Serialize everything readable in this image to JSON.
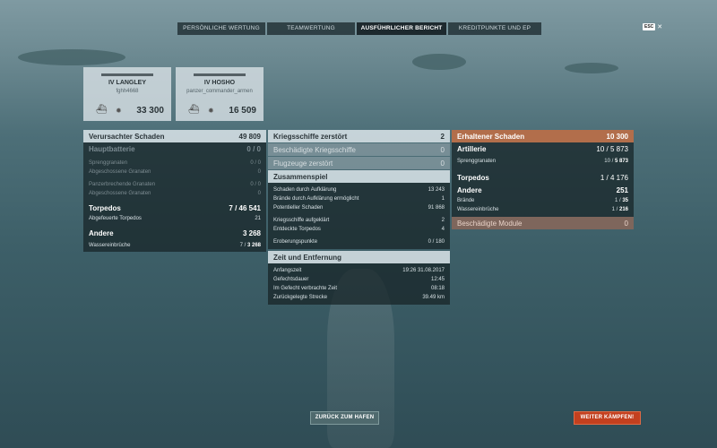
{
  "tabs": [
    {
      "label": "Persönliche Wertung",
      "active": false
    },
    {
      "label": "Teamwertung",
      "active": false
    },
    {
      "label": "Ausführlicher Bericht",
      "active": true
    },
    {
      "label": "Kreditpunkte und EP",
      "active": false
    }
  ],
  "close": {
    "esc": "ESC",
    "x": "✕"
  },
  "cards": [
    {
      "name": "IV LANGLEY",
      "player": "fghh4668",
      "score": "33 300"
    },
    {
      "name": "IV HOSHO",
      "player": "panzer_commander_armen",
      "score": "16 509"
    }
  ],
  "left": {
    "header": {
      "label": "Verursachter Schaden",
      "value": "49 809"
    },
    "hauptbatterie": {
      "label": "Hauptbatterie",
      "value": "0 / 0"
    },
    "hb_lines": [
      {
        "label": "Sprenggranaten",
        "value": "0 / 0"
      },
      {
        "label": "Abgeschossene Granaten",
        "value": "0"
      },
      {
        "label": "Panzerbrechende Granaten",
        "value": "0 / 0"
      },
      {
        "label": "Abgeschossene Granaten",
        "value": "0"
      }
    ],
    "torpedos": {
      "label": "Torpedos",
      "value_a": "7",
      "value_b": "46 541"
    },
    "torp_line": {
      "label": "Abgefeuerte Torpedos",
      "value": "21"
    },
    "andere": {
      "label": "Andere",
      "value": "3 268"
    },
    "andere_line": {
      "label": "Wassereinbrüche",
      "value_a": "7",
      "value_b": "3 268"
    }
  },
  "middle": {
    "kriegsschiffe": {
      "label": "Kriegsschiffe zerstört",
      "value": "2"
    },
    "beschaedigte": {
      "label": "Beschädigte Kriegsschiffe",
      "value": "0"
    },
    "flugzeuge": {
      "label": "Flugzeuge zerstört",
      "value": "0"
    },
    "zusammen": {
      "label": "Zusammenspiel"
    },
    "zusammen_lines": [
      {
        "label": "Schaden durch Aufklärung",
        "value": "13 243"
      },
      {
        "label": "Brände durch Aufklärung ermöglicht",
        "value": "1"
      },
      {
        "label": "Potentieller Schaden",
        "value": "91 868"
      },
      {
        "label": "Kriegsschiffe aufgeklärt",
        "value": "2"
      },
      {
        "label": "Entdeckte Torpedos",
        "value": "4"
      },
      {
        "label": "Eroberungspunkte",
        "value": "0 / 180"
      }
    ],
    "zeit": {
      "label": "Zeit und Entfernung"
    },
    "zeit_lines": [
      {
        "label": "Anfangszeit",
        "value": "19:26  31.08.2017"
      },
      {
        "label": "Gefechtsdauer",
        "value": "12:45"
      },
      {
        "label": "Im Gefecht verbrachte Zeit",
        "value": "08:18"
      },
      {
        "label": "Zurückgelegte Strecke",
        "value": "39.49 km"
      }
    ]
  },
  "right": {
    "header": {
      "label": "Erhaltener Schaden",
      "value": "10 300"
    },
    "artillerie": {
      "label": "Artillerie",
      "value_a": "10",
      "value_b": "5 873"
    },
    "art_line": {
      "label": "Sprenggranaten",
      "value_a": "10",
      "value_b": "5 873"
    },
    "torpedos": {
      "label": "Torpedos",
      "value_a": "1",
      "value_b": "4 176"
    },
    "andere": {
      "label": "Andere",
      "value": "251"
    },
    "andere_lines": [
      {
        "label": "Brände",
        "value_a": "1",
        "value_b": "35"
      },
      {
        "label": "Wassereinbrüche",
        "value_a": "1",
        "value_b": "216"
      }
    ],
    "module": {
      "label": "Beschädigte Module",
      "value": "0"
    }
  },
  "buttons": {
    "harbor": "Zurück zum Hafen",
    "battle": "Weiter kämpfen!"
  }
}
